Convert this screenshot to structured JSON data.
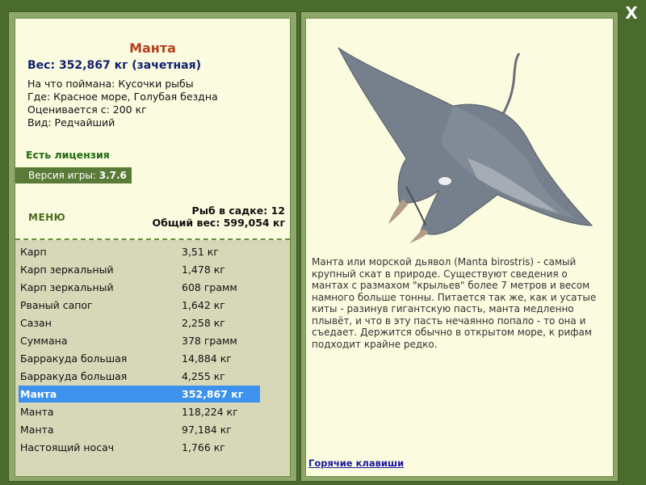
{
  "close": "X",
  "fish": {
    "name": "Манта",
    "weight_line": "Вес: 352,867 кг (зачетная)",
    "bait_line": "На что поймана: Кусочки рыбы",
    "place_line": "Где: Красное море, Голубая бездна",
    "value_line": "Оценивается с: 200 кг",
    "kind_line": "Вид: Редчайший"
  },
  "license": "Есть лицензия",
  "version": {
    "label": "Версия игры:",
    "value": "3.7.6"
  },
  "menu_label": "МЕНЮ",
  "cage": {
    "count_line": "Рыб в садке: 12",
    "total_line": "Общий вес: 599,054 кг"
  },
  "catch_list": [
    {
      "name": "Карп",
      "weight": "3,51 кг",
      "selected": false
    },
    {
      "name": "Карп зеркальный",
      "weight": "1,478 кг",
      "selected": false
    },
    {
      "name": "Карп зеркальный",
      "weight": "608 грамм",
      "selected": false
    },
    {
      "name": "Рваный сапог",
      "weight": "1,642 кг",
      "selected": false
    },
    {
      "name": "Сазан",
      "weight": "2,258 кг",
      "selected": false
    },
    {
      "name": "Суммана",
      "weight": "378 грамм",
      "selected": false
    },
    {
      "name": "Барракуда большая",
      "weight": "14,884 кг",
      "selected": false
    },
    {
      "name": "Барракуда большая",
      "weight": "4,255 кг",
      "selected": false
    },
    {
      "name": "Манта",
      "weight": "352,867 кг",
      "selected": true
    },
    {
      "name": "Манта",
      "weight": "118,224 кг",
      "selected": false
    },
    {
      "name": "Манта",
      "weight": "97,184 кг",
      "selected": false
    },
    {
      "name": "Настоящий носач",
      "weight": "1,766 кг",
      "selected": false
    }
  ],
  "description": "Манта или морской дьявол (Manta birostris) - самый крупный скат в природе. Существуют сведения о мантах с размахом \"крыльев\" более 7 метров и весом намного больше тонны. Питается так же, как и усатые киты - разинув гигантскую пасть, манта медленно плывёт, и что в эту пасть нечаянно попало - то она и съедает. Держится обычно в открытом море, к рифам подходит крайне редко.",
  "hotkeys_label": "Горячие клавиши",
  "colors": {
    "background": "#4a6a2e",
    "panel": "#fbfbe0",
    "list_background": "#d7d8b8",
    "selected_row": "#3d92ee",
    "title": "#b2401a",
    "weight": "#12206e",
    "license": "#1f6a10"
  },
  "icons": {
    "close": "close-icon"
  }
}
